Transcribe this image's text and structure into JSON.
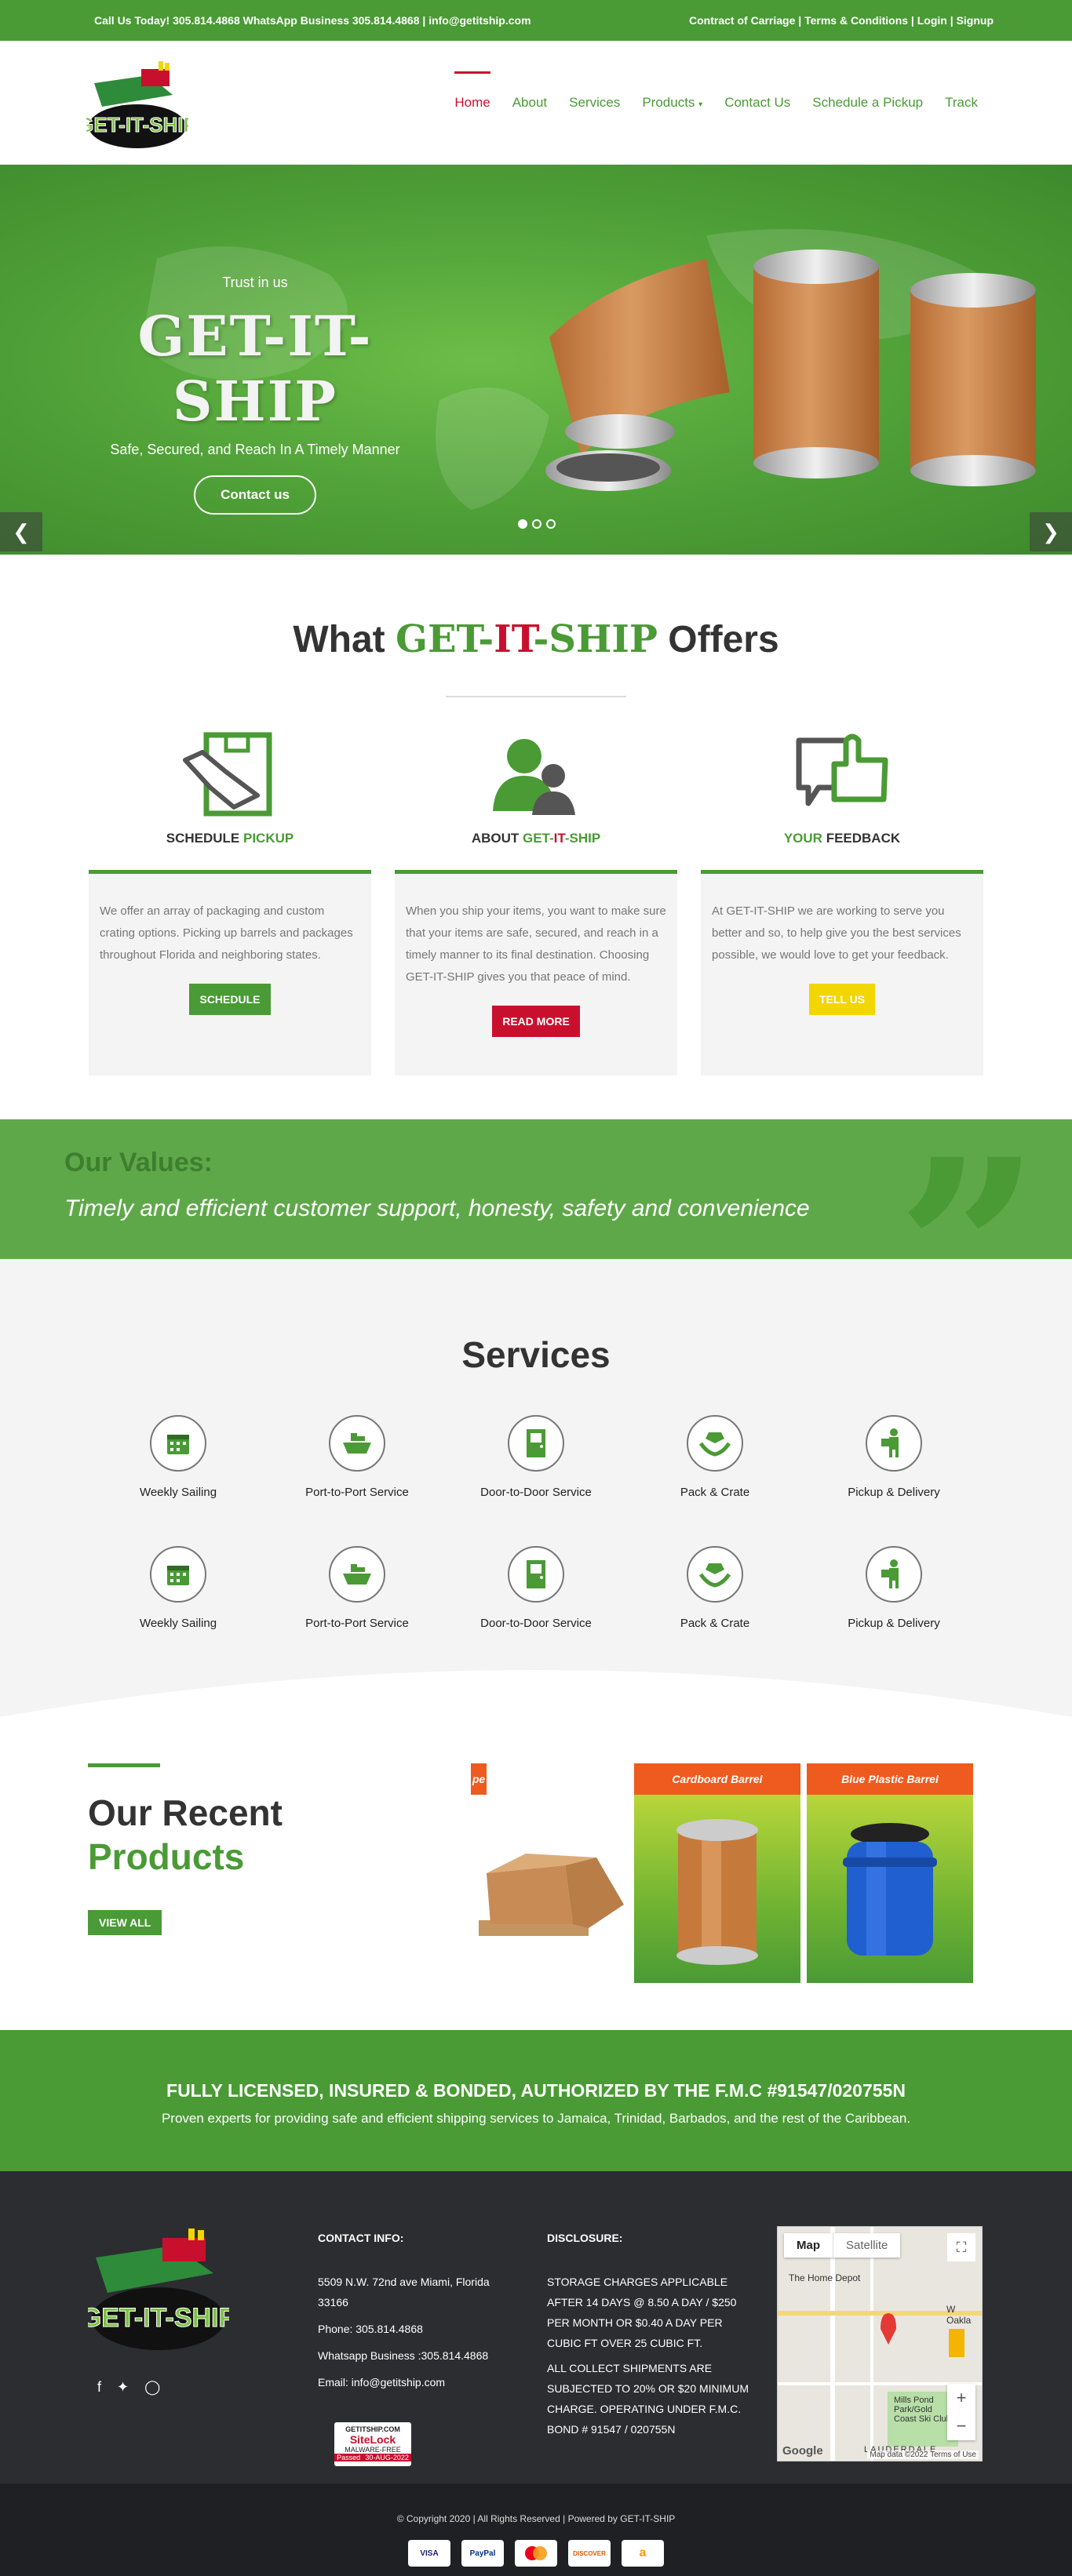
{
  "topbar": {
    "left": "Call Us Today! 305.814.4868 WhatsApp Business 305.814.4868 | info@getitship.com",
    "links": [
      "Contract of Carriage",
      "Terms & Conditions",
      "Login",
      "Signup"
    ],
    "separator": " | "
  },
  "brand": {
    "logo_text": "GET-IT-SHIP",
    "green": "#4a9a35",
    "red": "#c8102e",
    "yellow": "#f2d600"
  },
  "nav": {
    "items": [
      "Home",
      "About",
      "Services",
      "Products",
      "Contact Us",
      "Schedule a Pickup",
      "Track"
    ],
    "active": "Home",
    "dropdown_icon": "caret-down-icon"
  },
  "hero": {
    "kicker": "Trust in us",
    "title": "GET-IT-SHIP",
    "subtitle": "Safe, Secured, and Reach In A Timely Manner",
    "button": "Contact us",
    "prev_icon": "chevron-left-icon",
    "next_icon": "chevron-right-icon",
    "slides_total": 3,
    "slide_active": 1
  },
  "offers": {
    "heading_pre": "What ",
    "heading_brand": [
      "GET-",
      "IT",
      "-SHIP"
    ],
    "heading_post": " Offers",
    "cards": [
      {
        "title_a": "SCHEDULE ",
        "title_b": "PICKUP",
        "title_c": "",
        "title_d": "",
        "icon": "package-hand-icon",
        "text": "We offer an array of packaging and custom crating options. Picking up barrels and packages throughout Florida and neighboring states.",
        "button": "SCHEDULE",
        "button_color": "#4a9a35"
      },
      {
        "title_a": "ABOUT ",
        "title_b": "GET-",
        "title_c": "IT",
        "title_d": "-SHIP",
        "icon": "users-icon",
        "text": "When you ship your items, you want to make sure that your items are safe, secured, and reach in a timely manner to its final destination. Choosing GET-IT-SHIP gives you that peace of mind.",
        "button": "READ MORE",
        "button_color": "#c8102e"
      },
      {
        "title_a": "",
        "title_b": "YOUR ",
        "title_c": "",
        "title_d": "FEEDBACK",
        "icon": "thumbs-up-chat-icon",
        "text": "At GET-IT-SHIP we are working to serve you better and so, to help give you the best services possible, we would love to get your feedback.",
        "button": "TELL US",
        "button_color": "#f2d600"
      }
    ]
  },
  "values": {
    "heading": "Our Values:",
    "text": "Timely and efficient customer support, honesty, safety and convenience",
    "quote_glyph": "”"
  },
  "services": {
    "heading": "Services",
    "items": [
      {
        "label": "Weekly Sailing",
        "icon": "calendar-icon"
      },
      {
        "label": "Port-to-Port Service",
        "icon": "ship-icon"
      },
      {
        "label": "Door-to-Door Service",
        "icon": "door-icon"
      },
      {
        "label": "Pack & Crate",
        "icon": "box-hands-icon"
      },
      {
        "label": "Pickup & Delivery",
        "icon": "delivery-person-icon"
      },
      {
        "label": "Weekly Sailing",
        "icon": "calendar-icon"
      },
      {
        "label": "Port-to-Port Service",
        "icon": "ship-icon"
      },
      {
        "label": "Door-to-Door Service",
        "icon": "door-icon"
      },
      {
        "label": "Pack & Crate",
        "icon": "box-hands-icon"
      },
      {
        "label": "Pickup & Delivery",
        "icon": "delivery-person-icon"
      }
    ]
  },
  "products": {
    "heading_a": "Our Recent",
    "heading_b": "Products",
    "button": "VIEW ALL",
    "cards": [
      {
        "title": "pe",
        "image": "cardboard-box-pallet"
      },
      {
        "title": "Cardboard Barrel",
        "image": "fiber-drum"
      },
      {
        "title": "Blue Plastic Barrel",
        "image": "blue-plastic-drum"
      }
    ]
  },
  "license": {
    "heading": "FULLY LICENSED, INSURED & BONDED, AUTHORIZED BY THE F.M.C #91547/020755N",
    "text": "Proven experts for providing safe and efficient shipping services to Jamaica, Trinidad, Barbados, and the rest of the Caribbean."
  },
  "footer": {
    "contact_heading": "CONTACT INFO:",
    "address": "5509 N.W. 72nd ave Miami, Florida 33166",
    "phone": "Phone: 305.814.4868",
    "whatsapp": "Whatsapp Business :305.814.4868",
    "email": "Email: info@getitship.com",
    "disclosure_heading": "DISCLOSURE:",
    "disclosure_1": "STORAGE CHARGES APPLICABLE AFTER 14 DAYS @ 8.50 A DAY / $250 PER MONTH OR $0.40 A DAY PER CUBIC FT OVER 25 CUBIC FT.",
    "disclosure_2": "ALL COLLECT SHIPMENTS ARE SUBJECTED TO 20% OR $20 MINIMUM CHARGE. OPERATING UNDER F.M.C. BOND # 91547 / 020755N",
    "socials": [
      "facebook-icon",
      "twitter-icon",
      "instagram-icon"
    ],
    "sitelock": {
      "top": "GETITSHIP.COM",
      "brand": "SiteLock",
      "sub": "MALWARE-FREE",
      "status": "Passed",
      "date": "30-AUG-2022"
    },
    "map": {
      "tab_map": "Map",
      "tab_satellite": "Satellite",
      "labels": [
        "The Home Depot",
        "W Oakla",
        "Mills Pond Park/Gold Coast Ski Club",
        "LAUDERDALE"
      ],
      "credit": "Map data ©2022   Terms of Use",
      "google": "Google",
      "zoom_in": "+",
      "zoom_out": "−"
    }
  },
  "bottom": {
    "copyright": "© Copyright 2020 | All Rights Reserved | Powered by GET-IT-SHIP",
    "payments": [
      "VISA",
      "PayPal",
      "Mastercard",
      "DISCOVER",
      "Amazon"
    ]
  }
}
